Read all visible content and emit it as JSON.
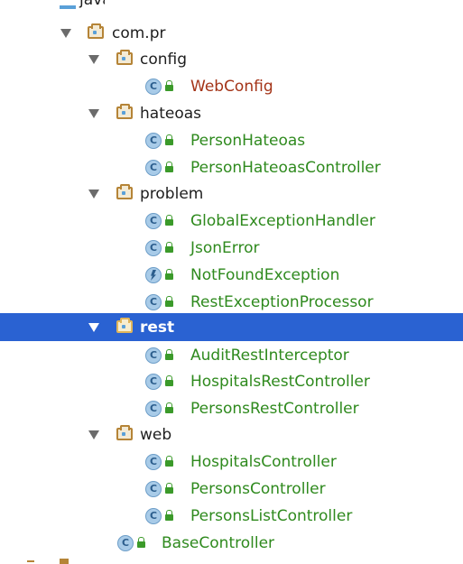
{
  "tree": {
    "top_partial_label": "java",
    "root_package": "com.pr",
    "packages": {
      "config": {
        "label": "config",
        "classes": [
          "WebConfig"
        ]
      },
      "hateoas": {
        "label": "hateoas",
        "classes": [
          "PersonHateoas",
          "PersonHateoasController"
        ]
      },
      "problem": {
        "label": "problem",
        "classes": [
          "GlobalExceptionHandler",
          "JsonError",
          "NotFoundException",
          "RestExceptionProcessor"
        ]
      },
      "rest": {
        "label": "rest",
        "classes": [
          "AuditRestInterceptor",
          "HospitalsRestController",
          "PersonsRestController"
        ]
      },
      "web": {
        "label": "web",
        "classes": [
          "HospitalsController",
          "PersonsController",
          "PersonsListController"
        ]
      }
    },
    "root_class": "BaseController",
    "selected_package": "rest",
    "icon_class_letter": "C"
  },
  "colors": {
    "selection": "#2a62d2",
    "class_green": "#2f8a1e",
    "class_red": "#a43418",
    "package_folder": "#b58437"
  },
  "icons": {
    "expand": "triangle-down-icon",
    "package": "package-folder-icon",
    "class": "class-c-icon",
    "exception": "exception-class-icon",
    "access": "lock-icon"
  }
}
